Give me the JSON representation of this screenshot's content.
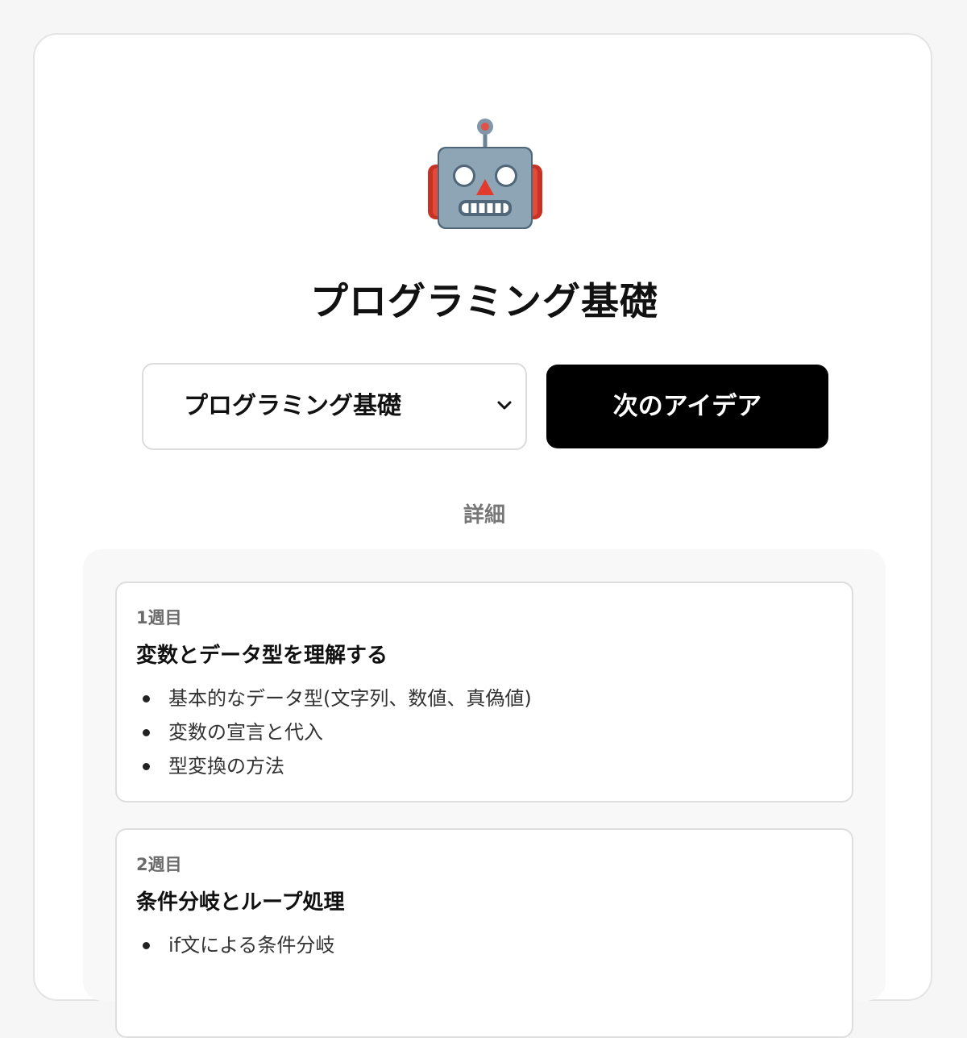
{
  "header": {
    "icon": "robot-icon",
    "title": "プログラミング基礎"
  },
  "controls": {
    "selected_course": "プログラミング基礎",
    "next_button_label": "次のアイデア"
  },
  "details": {
    "label": "詳細",
    "weeks": [
      {
        "label": "1週目",
        "title": "変数とデータ型を理解する",
        "items": [
          "基本的なデータ型(文字列、数値、真偽値)",
          "変数の宣言と代入",
          "型変換の方法"
        ]
      },
      {
        "label": "2週目",
        "title": "条件分岐とループ処理",
        "items": [
          "if文による条件分岐"
        ]
      }
    ]
  },
  "colors": {
    "background": "#f6f6f6",
    "button": "#000000",
    "muted_text": "#777777"
  }
}
